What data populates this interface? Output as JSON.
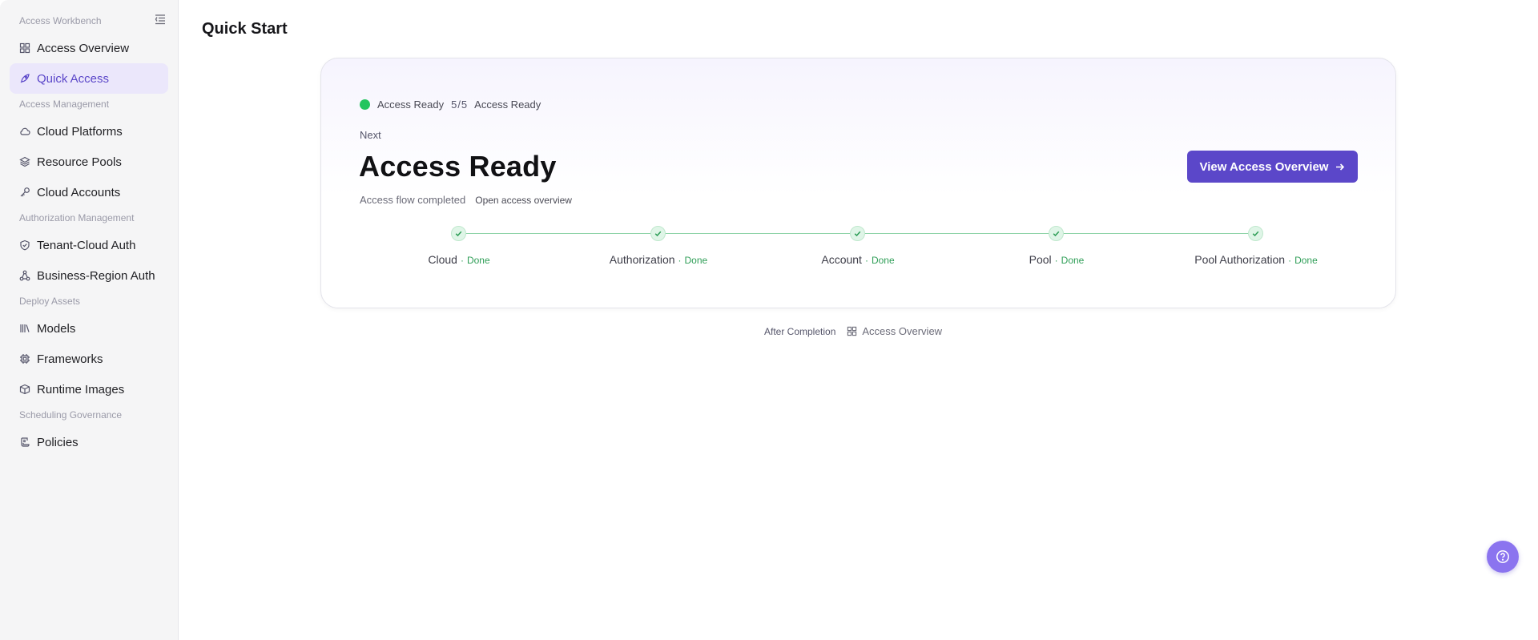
{
  "sidebar": {
    "workbench_title": "Access Workbench",
    "sections": [
      {
        "title": "Access Management"
      },
      {
        "title": "Authorization Management"
      },
      {
        "title": "Deploy Assets"
      },
      {
        "title": "Scheduling Governance"
      }
    ],
    "items": [
      {
        "label": "Access Overview",
        "icon": "grid-icon"
      },
      {
        "label": "Quick Access",
        "icon": "rocket-icon",
        "active": true
      },
      {
        "label": "Cloud Platforms",
        "icon": "cloud-icon"
      },
      {
        "label": "Resource Pools",
        "icon": "layers-icon"
      },
      {
        "label": "Cloud Accounts",
        "icon": "key-icon"
      },
      {
        "label": "Tenant-Cloud Auth",
        "icon": "shield-icon"
      },
      {
        "label": "Business-Region Auth",
        "icon": "network-icon"
      },
      {
        "label": "Models",
        "icon": "library-icon"
      },
      {
        "label": "Frameworks",
        "icon": "chip-icon"
      },
      {
        "label": "Runtime Images",
        "icon": "box-icon"
      },
      {
        "label": "Policies",
        "icon": "policy-icon"
      }
    ]
  },
  "page": {
    "title": "Quick Start"
  },
  "card": {
    "status": "Access Ready",
    "progress": "5/5",
    "status_repeat": "Access Ready",
    "next_label": "Next",
    "hero_title": "Access Ready",
    "description": "Access flow completed",
    "link": "Open access overview",
    "cta_label": "View Access Overview",
    "steps": [
      {
        "name": "Cloud",
        "status": "Done"
      },
      {
        "name": "Authorization",
        "status": "Done"
      },
      {
        "name": "Account",
        "status": "Done"
      },
      {
        "name": "Pool",
        "status": "Done"
      },
      {
        "name": "Pool Authorization",
        "status": "Done"
      }
    ]
  },
  "after": {
    "label": "After Completion",
    "target": "Access Overview"
  },
  "colors": {
    "accent": "#5b47c9",
    "success": "#22c55e",
    "fab": "#8b74ef"
  }
}
